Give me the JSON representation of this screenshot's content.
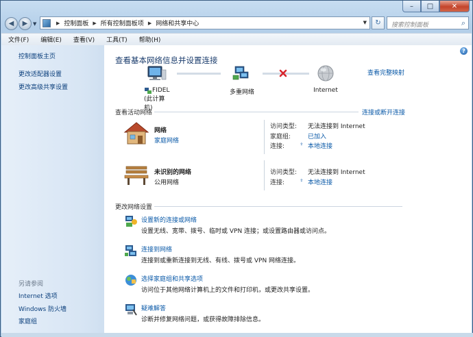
{
  "window": {
    "caption_buttons": {
      "minimize": "–",
      "maximize": "□",
      "close": "✕"
    }
  },
  "nav": {
    "back": "◀",
    "forward": "▶",
    "breadcrumbs": [
      "控制面板",
      "所有控制面板项",
      "网络和共享中心"
    ],
    "search_placeholder": "搜索控制面板"
  },
  "menu": [
    "文件(F)",
    "编辑(E)",
    "查看(V)",
    "工具(T)",
    "帮助(H)"
  ],
  "sidebar": {
    "links": [
      "控制面板主页",
      "更改适配器设置",
      "更改高级共享设置"
    ],
    "see_also_label": "另请参阅",
    "see_also": [
      "Internet 选项",
      "Windows 防火墙",
      "家庭组"
    ]
  },
  "main": {
    "help_icon": "?",
    "title": "查看基本网络信息并设置连接",
    "full_map_link": "查看完整映射",
    "map": {
      "computer": {
        "name": "FIDEL",
        "subtitle": "(此计算机)"
      },
      "network": "多重网络",
      "internet": "Internet"
    },
    "active_networks": {
      "heading": "查看活动网络",
      "connect_link": "连接或断开连接",
      "networks": [
        {
          "name": "网络",
          "type": "家庭网络",
          "type_is_link": true,
          "rows": [
            {
              "key": "访问类型:",
              "value": "无法连接到 Internet"
            },
            {
              "key": "家庭组:",
              "value": "已加入"
            },
            {
              "key": "连接:",
              "value": "本地连接"
            }
          ]
        },
        {
          "name": "未识别的网络",
          "type": "公用网络",
          "type_is_link": false,
          "rows": [
            {
              "key": "访问类型:",
              "value": "无法连接到 Internet"
            },
            {
              "key": "连接:",
              "value": "本地连接"
            }
          ]
        }
      ]
    },
    "settings": {
      "heading": "更改网络设置",
      "tasks": [
        {
          "title": "设置新的连接或网络",
          "desc": "设置无线、宽带、拨号、临时或 VPN 连接；或设置路由器或访问点。"
        },
        {
          "title": "连接到网络",
          "desc": "连接到或重新连接到无线、有线、拨号或 VPN 网络连接。"
        },
        {
          "title": "选择家庭组和共享选项",
          "desc": "访问位于其他网络计算机上的文件和打印机，或更改共享设置。"
        },
        {
          "title": "疑难解答",
          "desc": "诊断并修复网络问题，或获得故障排除信息。"
        }
      ]
    }
  },
  "colors": {
    "link": "#0b5aa8",
    "title": "#1b3d6d",
    "broken_link_x": "#d7262e",
    "sidebar_bg": "#dce8f5"
  }
}
